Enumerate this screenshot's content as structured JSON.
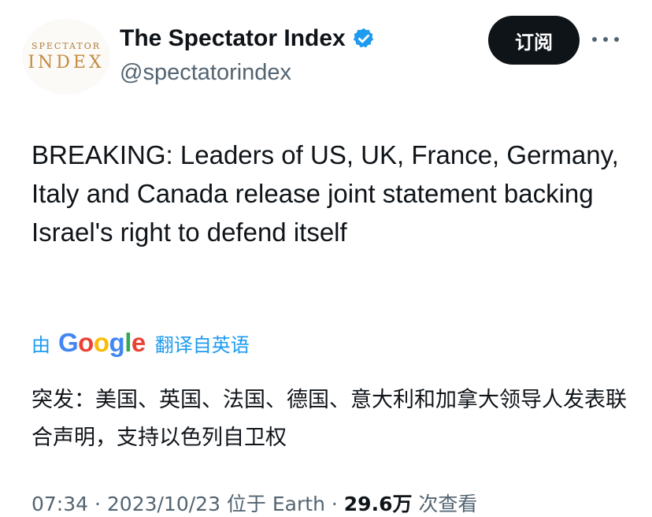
{
  "account": {
    "avatar_line1": "SPECTATOR",
    "avatar_line2": "INDEX",
    "display_name": "The Spectator Index",
    "handle": "@spectatorindex",
    "verified_icon": "verified-badge-icon"
  },
  "actions": {
    "subscribe_label": "订阅",
    "more_icon": "more-dots-icon"
  },
  "tweet": {
    "text": "BREAKING: Leaders of US, UK, France, Germany, Italy and Canada release joint statement backing Israel's right to defend itself"
  },
  "translation": {
    "by_label": "由",
    "provider": "Google",
    "action_label": "翻译自英语",
    "text": "突发：美国、英国、法国、德国、意大利和加拿大领导人发表联合声明，支持以色列自卫权"
  },
  "meta": {
    "time": "07:34",
    "sep1": " · ",
    "date": "2023/10/23",
    "location_prefix": " 位于 ",
    "location": "Earth",
    "sep2": " · ",
    "views": "29.6万",
    "views_suffix": " 次查看"
  },
  "colors": {
    "accent": "#1d9bf0",
    "text": "#0f1419",
    "secondary": "#536471",
    "button_bg": "#0f1419"
  }
}
